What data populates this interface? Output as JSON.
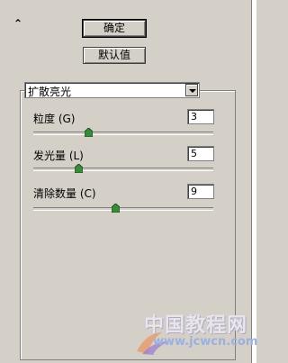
{
  "panel": {
    "collapse_glyph": "⌃",
    "ok_label": "确定",
    "default_label": "默认值"
  },
  "filter": {
    "name": "扩散亮光",
    "params": [
      {
        "label": "粒度 (G)",
        "value": "3",
        "slider_fraction": 0.3
      },
      {
        "label": "发光量 (L)",
        "value": "5",
        "slider_fraction": 0.25
      },
      {
        "label": "清除数量 (C)",
        "value": "9",
        "slider_fraction": 0.45
      }
    ]
  },
  "watermark": {
    "title": "中国教程网",
    "url": "www.jcwcn.com"
  },
  "colors": {
    "panel_bg": "#d4d0c8",
    "thumb": "#3a8a3a"
  }
}
